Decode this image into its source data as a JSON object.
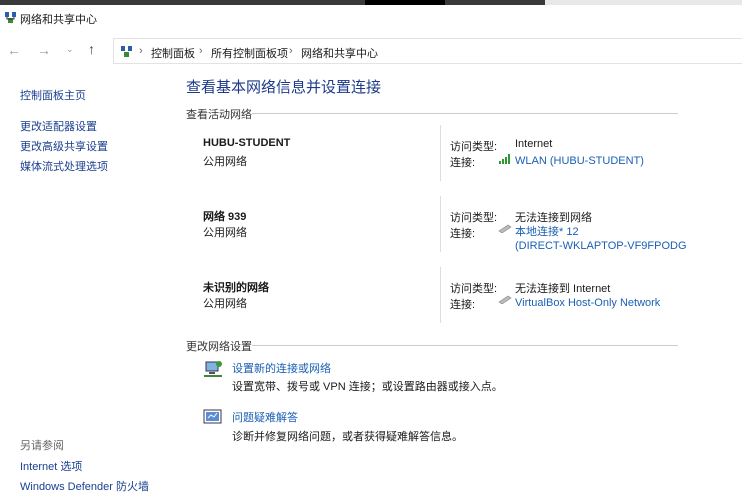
{
  "window": {
    "title": "网络和共享中心"
  },
  "breadcrumb": [
    "控制面板",
    "所有控制面板项",
    "网络和共享中心"
  ],
  "sidebar": {
    "items": [
      "控制面板主页",
      "更改适配器设置",
      "更改高级共享设置",
      "媒体流式处理选项"
    ],
    "see_also_title": "另请参阅",
    "see_also": [
      "Internet 选项",
      "Windows Defender 防火墙"
    ]
  },
  "main": {
    "title": "查看基本网络信息并设置连接",
    "active_header": "查看活动网络",
    "access_label": "访问类型:",
    "conn_label": "连接:",
    "networks": [
      {
        "name": "HUBU-STUDENT",
        "type": "公用网络",
        "access": "Internet",
        "conn": "WLAN (HUBU-STUDENT)",
        "conn2": "",
        "icon": "wifi-signal-icon"
      },
      {
        "name": "网络 939",
        "type": "公用网络",
        "access": "无法连接到网络",
        "conn": "本地连接* 12",
        "conn2": "(DIRECT-WKLAPTOP-VF9FPODG",
        "icon": "ethernet-cable-icon"
      },
      {
        "name": "未识别的网络",
        "type": "公用网络",
        "access": "无法连接到 Internet",
        "conn": "VirtualBox Host-Only Network",
        "conn2": "",
        "icon": "ethernet-cable-icon"
      }
    ],
    "change_header": "更改网络设置",
    "tasks": [
      {
        "link": "设置新的连接或网络",
        "desc": "设置宽带、拨号或 VPN 连接；或设置路由器或接入点。"
      },
      {
        "link": "问题疑难解答",
        "desc": "诊断并修复网络问题，或者获得疑难解答信息。"
      }
    ]
  },
  "colors": {
    "link": "#1a5fb4",
    "wifi": "#2e9a2e"
  }
}
